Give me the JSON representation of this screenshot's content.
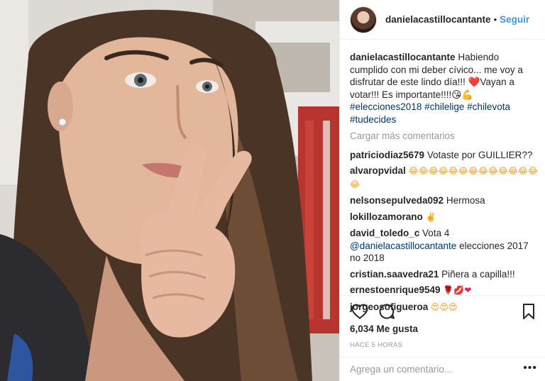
{
  "post": {
    "username": "danielacastillocantante",
    "follow_label": "Seguir",
    "separator": "•"
  },
  "caption": {
    "username": "danielacastillocantante",
    "text": "Habiendo cumplido con mi deber cívico... me voy a disfrutar de este lindo día!!! ❤️Vayan a votar!!! Es importante!!!!😘💪",
    "tags": [
      "#elecciones2018",
      "#chilelige",
      "#chilevota",
      "#tudecides"
    ]
  },
  "load_more": "Cargar más comentarios",
  "comments": [
    {
      "user": "patriciodiaz5679",
      "text": "Votaste por GUILLIER??"
    },
    {
      "user": "alvaropvidal",
      "text": "😂😂😂😂😂😂😂😂😂😂😂😂😂😂"
    },
    {
      "user": "nelsonsepulveda092",
      "text": "Hermosa"
    },
    {
      "user": "lokillozamorano",
      "text": "✌️"
    },
    {
      "user": "david_toledo_c",
      "text": "Vota 4",
      "mention": "@danielacastillocantante",
      "text_after": "elecciones 2017 no 2018"
    },
    {
      "user": "cristian.saavedra21",
      "text": "Piñera a capilla!!!"
    },
    {
      "user": "ernestoenrique9549",
      "text": "🌹💋❤"
    },
    {
      "user": "jorgeosofigueroa",
      "text": "😍😍😍"
    }
  ],
  "likes": "6,034 Me gusta",
  "timestamp": "HACE 5 HORAS",
  "add_comment_placeholder": "Agrega un comentario...",
  "icons": [
    "heart-icon",
    "comment-icon",
    "bookmark-icon",
    "more-options-icon"
  ],
  "colors": {
    "link_blue": "#3897f0",
    "hashtag": "#003569",
    "muted": "#999999",
    "text": "#262626"
  }
}
